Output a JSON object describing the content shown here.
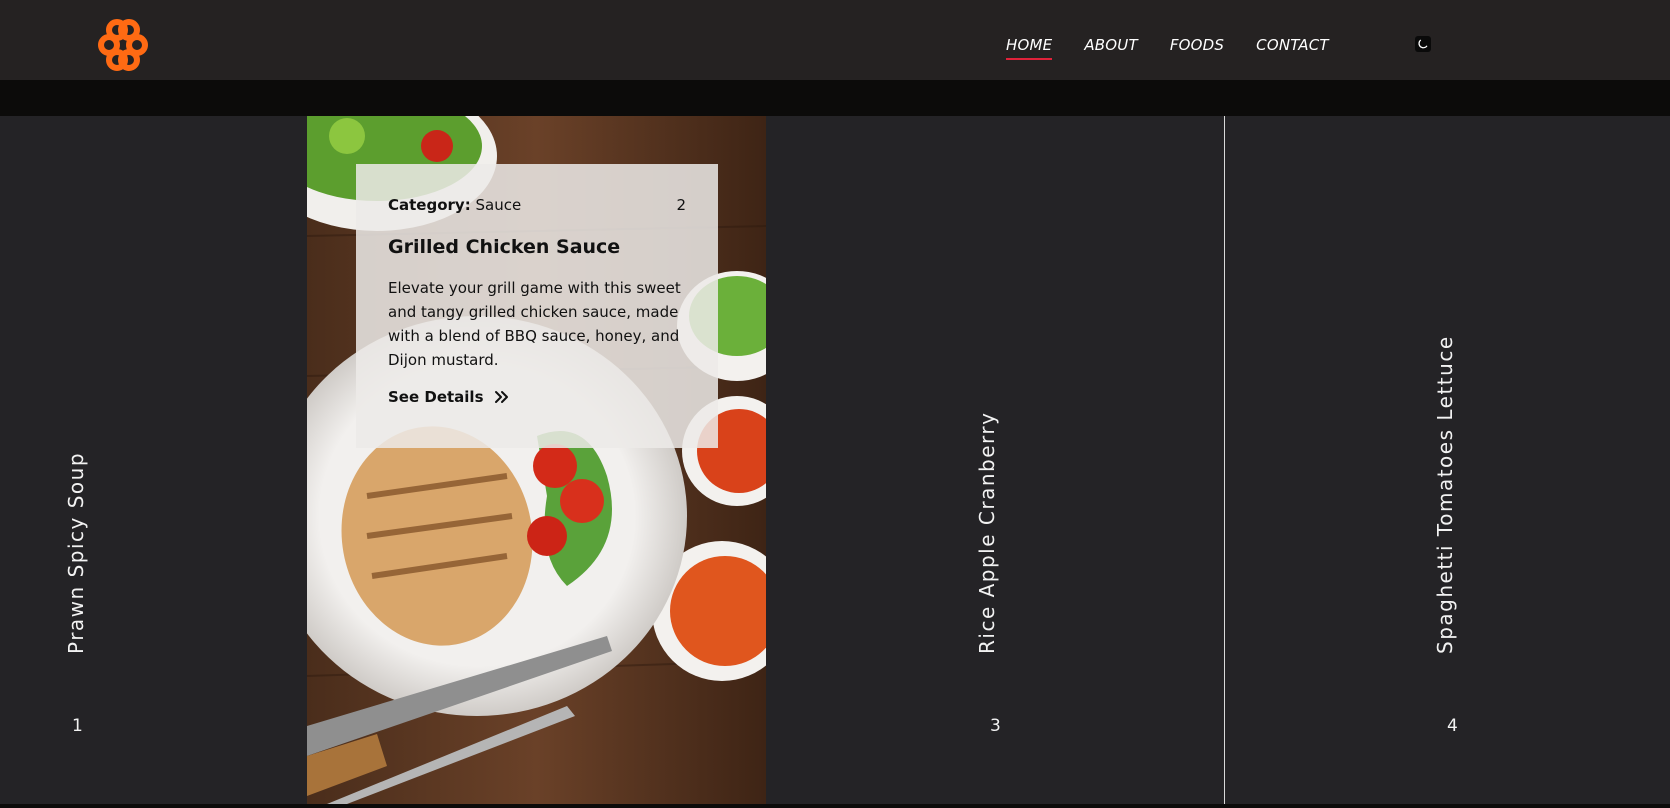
{
  "header": {
    "logo_icon": "orange-clover-logo",
    "brand_color": "#ff6a13",
    "nav": [
      {
        "label": "HOME",
        "active": true
      },
      {
        "label": "ABOUT",
        "active": false
      },
      {
        "label": "FOODS",
        "active": false
      },
      {
        "label": "CONTACT",
        "active": false
      }
    ],
    "theme_icon": "moon-icon",
    "accent_color": "#e0223a"
  },
  "panels": [
    {
      "title": "Prawn Spicy Soup",
      "number": "1"
    },
    {
      "title": "Rice Apple Cranberry",
      "number": "3"
    },
    {
      "title": "Spaghetti Tomatoes Lettuce",
      "number": "4"
    }
  ],
  "featured": {
    "category_label": "Category:",
    "category": "Sauce",
    "number": "2",
    "title": "Grilled Chicken Sauce",
    "description": "Elevate your grill game with this sweet and tangy grilled chicken sauce, made with a blend of BBQ sauce, honey, and Dijon mustard.",
    "link_label": "See Details",
    "link_icon": "double-chevron-right-icon",
    "image_icon": "grilled-chicken-plate-photo"
  }
}
